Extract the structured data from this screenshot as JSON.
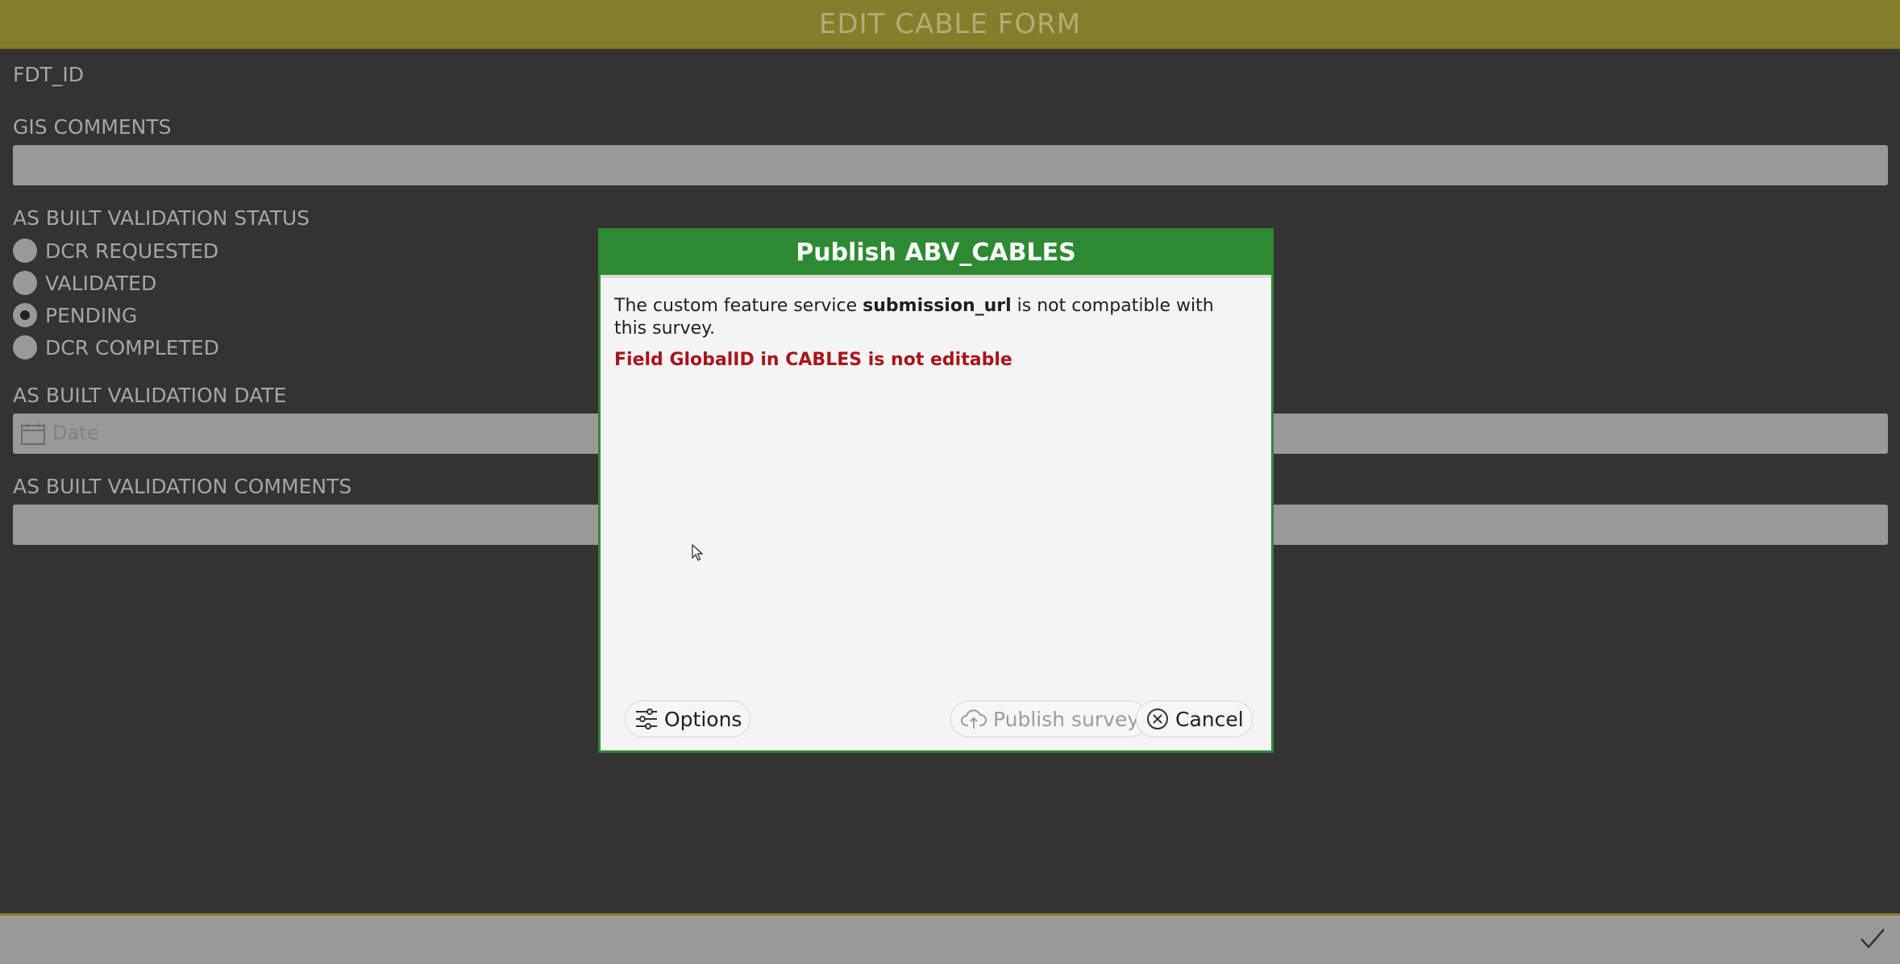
{
  "header": {
    "title": "EDIT CABLE FORM"
  },
  "form": {
    "fdt_id_label": "FDT_ID",
    "gis_comments_label": "GIS COMMENTS",
    "status_label": "AS BUILT VALIDATION STATUS",
    "status_options": [
      {
        "label": "DCR REQUESTED",
        "selected": false
      },
      {
        "label": "VALIDATED",
        "selected": false
      },
      {
        "label": "PENDING",
        "selected": true
      },
      {
        "label": "DCR COMPLETED",
        "selected": false
      }
    ],
    "date_label": "AS BUILT VALIDATION DATE",
    "date_placeholder": "Date",
    "comments_label": "AS BUILT VALIDATION COMMENTS"
  },
  "dialog": {
    "title": "Publish ABV_CABLES",
    "message_prefix": "The custom feature service ",
    "message_service": "submission_url",
    "message_suffix": " is not compatible with this survey.",
    "error": "Field GlobalID in CABLES is not editable",
    "options_label": "Options",
    "publish_label": "Publish survey",
    "cancel_label": "Cancel"
  },
  "colors": {
    "header": "#857d2b",
    "background": "#333333",
    "dialog_accent": "#2e8a32",
    "error": "#a8141b"
  },
  "icons": [
    "calendar-icon",
    "checkmark-icon",
    "options-sliders-icon",
    "cloud-upload-icon",
    "cancel-circle-icon",
    "mouse-cursor-icon"
  ]
}
